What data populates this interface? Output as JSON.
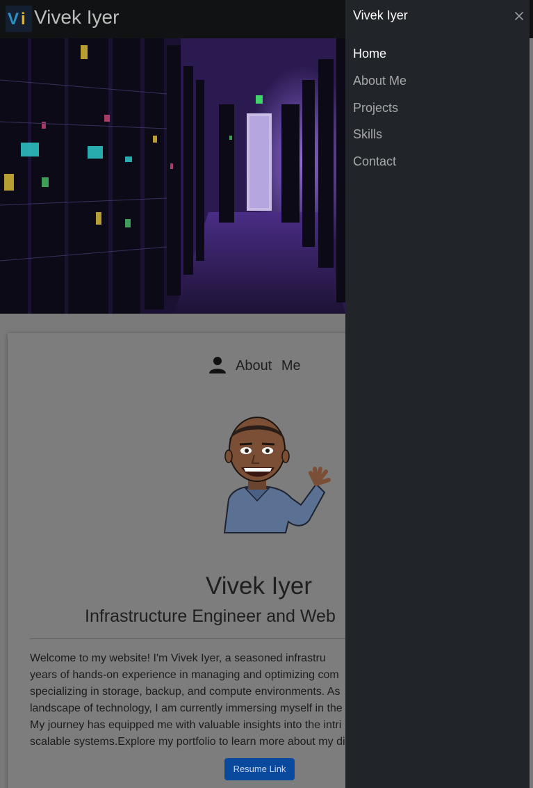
{
  "navbar": {
    "brand_logo_text": "Vi",
    "brand_name": "Vivek Iyer"
  },
  "about": {
    "heading": "About Me",
    "name": "Vivek Iyer",
    "title": "Infrastructure Engineer and Web",
    "bio_lines": [
      "Welcome to my website! I'm Vivek Iyer, a seasoned infrastru",
      "years of hands-on experience in managing and optimizing com",
      "specializing in storage, backup, and compute environments. As",
      "landscape of technology, I am currently immersing myself in the",
      "My journey has equipped me with valuable insights into the intri",
      "scalable systems.Explore my portfolio to learn more about my di"
    ],
    "resume_label": "Resume Link"
  },
  "offcanvas": {
    "title": "Vivek Iyer",
    "items": [
      {
        "label": "Home",
        "active": true
      },
      {
        "label": "About Me",
        "active": false
      },
      {
        "label": "Projects",
        "active": false
      },
      {
        "label": "Skills",
        "active": false
      },
      {
        "label": "Contact",
        "active": false
      }
    ]
  },
  "icons": {
    "close": "close-icon",
    "user": "user-icon"
  },
  "colors": {
    "offcanvas_bg": "#212529",
    "resume_button": "#0a4a9e",
    "navbar_bg": "#111213"
  }
}
